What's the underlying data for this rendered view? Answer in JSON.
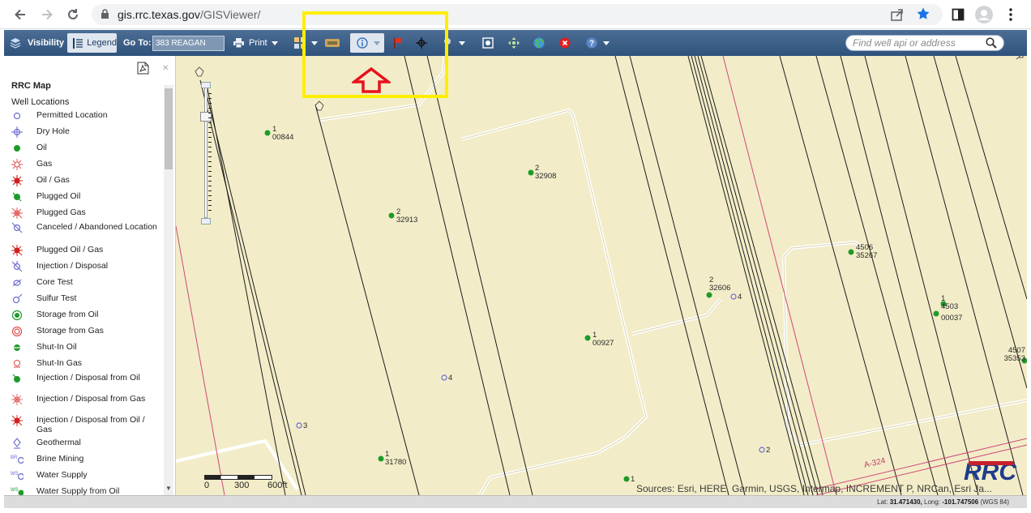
{
  "browser": {
    "url_host": "gis.rrc.texas.gov",
    "url_path": "/GISViewer/"
  },
  "toolbar": {
    "visibility_label": "Visibility",
    "legend_label": "Legend",
    "goto_label": "Go To:",
    "goto_value": "383 REAGAN",
    "print_label": "Print",
    "search_placeholder": "Find well api or address"
  },
  "legend": {
    "title": "RRC Map",
    "subtitle": "Well Locations",
    "items": [
      {
        "label": "Permitted Location",
        "icon": "permitted-location-icon"
      },
      {
        "label": "Dry Hole",
        "icon": "dry-hole-icon"
      },
      {
        "label": "Oil",
        "icon": "oil-icon"
      },
      {
        "label": "Gas",
        "icon": "gas-icon"
      },
      {
        "label": "Oil / Gas",
        "icon": "oil-gas-icon"
      },
      {
        "label": "Plugged Oil",
        "icon": "plugged-oil-icon"
      },
      {
        "label": "Plugged Gas",
        "icon": "plugged-gas-icon"
      },
      {
        "label": "Canceled / Abandoned Location",
        "icon": "canceled-location-icon"
      },
      {
        "label": "Plugged Oil / Gas",
        "icon": "plugged-oil-gas-icon"
      },
      {
        "label": "Injection / Disposal",
        "icon": "injection-disposal-icon"
      },
      {
        "label": "Core Test",
        "icon": "core-test-icon"
      },
      {
        "label": "Sulfur Test",
        "icon": "sulfur-test-icon"
      },
      {
        "label": "Storage from Oil",
        "icon": "storage-oil-icon"
      },
      {
        "label": "Storage from Gas",
        "icon": "storage-gas-icon"
      },
      {
        "label": "Shut-In Oil",
        "icon": "shut-in-oil-icon"
      },
      {
        "label": "Shut-In Gas",
        "icon": "shut-in-gas-icon"
      },
      {
        "label": "Injection / Disposal from Oil",
        "icon": "injection-oil-icon"
      },
      {
        "label": "Injection / Disposal from Gas",
        "icon": "injection-gas-icon"
      },
      {
        "label": "Injection / Disposal from Oil / Gas",
        "icon": "injection-oil-gas-icon"
      },
      {
        "label": "Geothermal",
        "icon": "geothermal-icon"
      },
      {
        "label": "Brine Mining",
        "icon": "brine-mining-icon"
      },
      {
        "label": "Water Supply",
        "icon": "water-supply-icon"
      },
      {
        "label": "Water Supply from Oil",
        "icon": "water-supply-oil-icon"
      }
    ]
  },
  "map": {
    "wells": [
      {
        "top": "1",
        "bottom": "00844"
      },
      {
        "top": "2",
        "bottom": "32908"
      },
      {
        "top": "2",
        "bottom": "32913"
      },
      {
        "top": "4506",
        "bottom": "35267"
      },
      {
        "top": "2",
        "bottom": "32606"
      },
      {
        "top": "",
        "bottom": "4"
      },
      {
        "top": "1",
        "bottom": "4503"
      },
      {
        "top": "",
        "bottom": "00037"
      },
      {
        "top": "1",
        "bottom": "00927"
      },
      {
        "top": "4507",
        "bottom": "35353"
      },
      {
        "top": "",
        "bottom": "4"
      },
      {
        "top": "",
        "bottom": "3"
      },
      {
        "top": "",
        "bottom": "2"
      },
      {
        "top": "1",
        "bottom": "31780"
      },
      {
        "top": "",
        "bottom": "1"
      }
    ],
    "survey_label": "A-324",
    "scale_labels": [
      "0",
      "300",
      "600ft"
    ],
    "attribution": "Sources: Esri, HERE, Garmin, USGS, Intermap, INCREMENT P, NRCan, Esri Ja..."
  },
  "status": {
    "lat_label": "Lat:",
    "lat_value": "31.471430,",
    "long_label": "Long:",
    "long_value": "-101.747506",
    "datum": "(WGS 84)"
  },
  "colors": {
    "toolbar": "#3a5d86",
    "map_background": "#f2edc8",
    "highlight": "#ffee00",
    "arrow": "#e8101b",
    "oil_well": "#1f9a2a"
  }
}
